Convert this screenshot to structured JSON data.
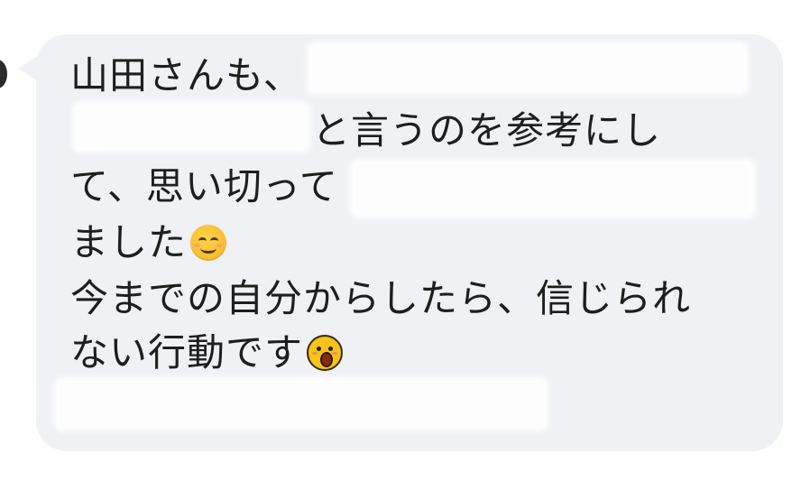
{
  "message": {
    "lines": [
      "山田さんも、",
      "と言うのを参考にし",
      "て、思い切って",
      "ました",
      "今までの自分からしたら、信じられ",
      "ない行動です"
    ],
    "emoji": [
      "smiling-face-emoji",
      "shocked-face-emoji"
    ]
  },
  "colors": {
    "bubble": "#f0f1f4",
    "text": "#1e1e1e",
    "redaction": "#ffffff"
  }
}
